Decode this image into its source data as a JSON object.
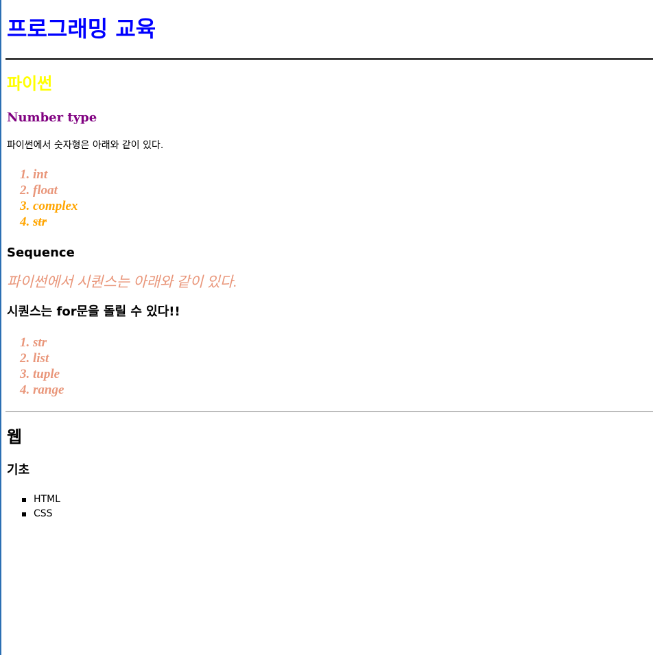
{
  "title": "프로그래밍 교육",
  "python": {
    "heading": "파이썬",
    "number_type": {
      "heading": "Number type",
      "description": "파이썬에서 숫자형은 아래와 같이 있다.",
      "items": [
        "1. int",
        "2. float",
        "3. complex",
        "4. str"
      ]
    },
    "sequence": {
      "heading": "Sequence",
      "description": "파이썬에서 시퀀스는 아래와 같이 있다.",
      "for_note": "시퀀스는 for문을 돌릴 수 있다!!",
      "items": [
        "1. str",
        "2. list",
        "3. tuple",
        "4. range"
      ]
    }
  },
  "web": {
    "heading": "웹",
    "basics": {
      "heading": "기초",
      "items": [
        "HTML",
        "CSS"
      ]
    }
  },
  "colors": {
    "title": "#0000ff",
    "python_heading": "#ffff00",
    "number_type_heading": "#800080",
    "list_salmon": "#e9967a",
    "list_orange": "#ffa500"
  }
}
